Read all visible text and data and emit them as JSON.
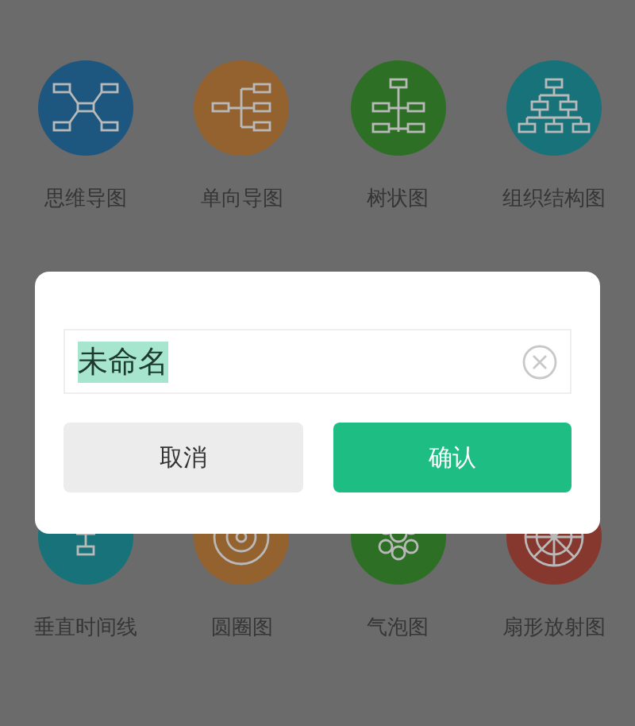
{
  "templates": [
    {
      "label": "思维导图",
      "color": "#1d5780"
    },
    {
      "label": "单向导图",
      "color": "#93622f"
    },
    {
      "label": "树状图",
      "color": "#2e6f26"
    },
    {
      "label": "组织结构图",
      "color": "#17727a"
    },
    {
      "label": "垂直时间线",
      "color": "#17727a"
    },
    {
      "label": "圆圈图",
      "color": "#93622f"
    },
    {
      "label": "气泡图",
      "color": "#2e6f26"
    },
    {
      "label": "扇形放射图",
      "color": "#86382f"
    }
  ],
  "dialog": {
    "name_field": {
      "value": "未命名",
      "text_selected": true
    },
    "buttons": [
      {
        "label": "取消",
        "kind": "secondary"
      },
      {
        "label": "确认",
        "kind": "primary"
      }
    ]
  }
}
